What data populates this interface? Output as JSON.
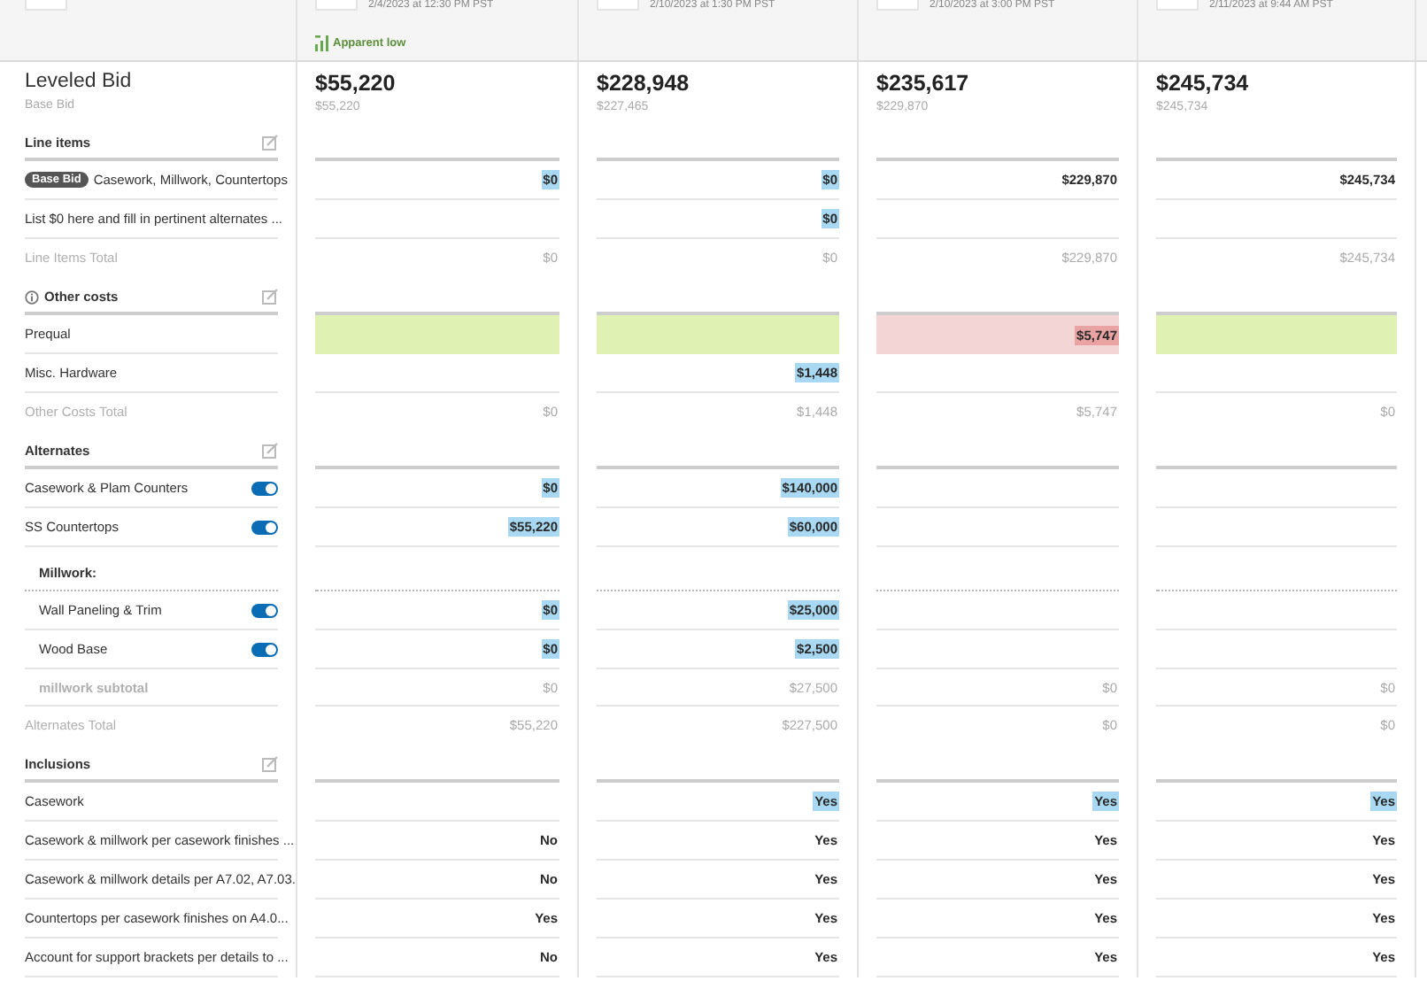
{
  "bidders": [
    {
      "date": "2/4/2023 at 12:30 PM PST",
      "badge": "Apparent low",
      "total": "$55,220",
      "subtotal": "$55,220"
    },
    {
      "date": "2/10/2023 at 1:30 PM PST",
      "total": "$228,948",
      "subtotal": "$227,465"
    },
    {
      "date": "2/10/2023 at 3:00 PM PST",
      "total": "$235,617",
      "subtotal": "$229,870"
    },
    {
      "date": "2/11/2023 at 9:44 AM PST",
      "total": "$245,734",
      "subtotal": "$245,734"
    }
  ],
  "summary": {
    "title": "Leveled Bid",
    "subtitle": "Base Bid"
  },
  "sections": [
    {
      "kind": "plain",
      "title": "Line items",
      "rows": [
        {
          "kind": "item",
          "tag": "Base Bid",
          "label": "Casework, Millwork, Countertops",
          "cells": [
            {
              "text": "$0",
              "selected": true
            },
            {
              "text": "$0",
              "selected": true
            },
            {
              "text": "$229,870",
              "selected": false
            },
            {
              "text": "$245,734",
              "selected": false
            }
          ]
        },
        {
          "kind": "item",
          "label": "List $0 here and fill in pertinent alternates ...",
          "cells": [
            {},
            {
              "text": "$0",
              "selected": true
            },
            {},
            {}
          ]
        },
        {
          "kind": "total",
          "label": "Line Items Total",
          "cells": [
            {
              "text": "$0"
            },
            {
              "text": "$0"
            },
            {
              "text": "$229,870"
            },
            {
              "text": "$245,734"
            }
          ]
        }
      ]
    },
    {
      "kind": "info",
      "title": "Other costs",
      "rows": [
        {
          "kind": "item",
          "label": "Prequal",
          "cells": [
            {
              "passed": true
            },
            {
              "passed": true
            },
            {
              "passed": false,
              "text": "$5,747",
              "flagged": true
            },
            {
              "passed": true
            }
          ]
        },
        {
          "kind": "item",
          "label": "Misc. Hardware",
          "cells": [
            {},
            {
              "text": "$1,448",
              "selected": true
            },
            {},
            {}
          ]
        },
        {
          "kind": "total",
          "label": "Other Costs Total",
          "cells": [
            {
              "text": "$0"
            },
            {
              "text": "$1,448"
            },
            {
              "text": "$5,747"
            },
            {
              "text": "$0"
            }
          ]
        }
      ]
    },
    {
      "kind": "plain",
      "title": "Alternates",
      "rows": [
        {
          "kind": "item",
          "label": "Casework & Plam Counters",
          "on": true,
          "cells": [
            {
              "text": "$0",
              "selected": true
            },
            {
              "text": "$140,000",
              "selected": true
            },
            {},
            {}
          ]
        },
        {
          "kind": "item",
          "label": "SS Countertops",
          "on": true,
          "cells": [
            {
              "text": "$55,220",
              "selected": true
            },
            {
              "text": "$60,000",
              "selected": true
            },
            {},
            {}
          ]
        },
        {
          "kind": "group",
          "label": "Millwork:",
          "children": [
            {
              "kind": "item",
              "label": "Wall Paneling & Trim",
              "on": true,
              "cells": [
                {
                  "text": "$0",
                  "selected": true
                },
                {
                  "text": "$25,000",
                  "selected": true
                },
                {},
                {}
              ]
            },
            {
              "kind": "item",
              "label": "Wood Base",
              "on": true,
              "cells": [
                {
                  "text": "$0",
                  "selected": true
                },
                {
                  "text": "$2,500",
                  "selected": true
                },
                {},
                {}
              ]
            },
            {
              "kind": "subtotal",
              "label": "millwork subtotal",
              "cells": [
                {
                  "text": "$0"
                },
                {
                  "text": "$27,500"
                },
                {
                  "text": "$0"
                },
                {
                  "text": "$0"
                }
              ]
            }
          ]
        },
        {
          "kind": "total",
          "label": "Alternates Total",
          "cells": [
            {
              "text": "$55,220"
            },
            {
              "text": "$227,500"
            },
            {
              "text": "$0"
            },
            {
              "text": "$0"
            }
          ]
        }
      ]
    },
    {
      "kind": "plain",
      "title": "Inclusions",
      "rows": [
        {
          "kind": "item",
          "label": "Casework",
          "cells": [
            {},
            {
              "text": "Yes",
              "selected": true
            },
            {
              "text": "Yes",
              "selected": true
            },
            {
              "text": "Yes",
              "selected": true
            }
          ]
        },
        {
          "kind": "item",
          "label": "Casework & millwork per casework finishes ...",
          "cells": [
            {
              "text": "No",
              "selected": false
            },
            {
              "text": "Yes",
              "selected": false
            },
            {
              "text": "Yes",
              "selected": false
            },
            {
              "text": "Yes",
              "selected": false
            }
          ]
        },
        {
          "kind": "item",
          "label": "Casework & millwork details per A7.02, A7.03.",
          "cells": [
            {
              "text": "No",
              "selected": false
            },
            {
              "text": "Yes",
              "selected": false
            },
            {
              "text": "Yes",
              "selected": false
            },
            {
              "text": "Yes",
              "selected": false
            }
          ]
        },
        {
          "kind": "item",
          "label": "Countertops per casework finishes on A4.0...",
          "cells": [
            {
              "text": "Yes",
              "selected": false
            },
            {
              "text": "Yes",
              "selected": false
            },
            {
              "text": "Yes",
              "selected": false
            },
            {
              "text": "Yes",
              "selected": false
            }
          ]
        },
        {
          "kind": "item",
          "label": "Account for support brackets per details to ...",
          "cells": [
            {
              "text": "No",
              "selected": false
            },
            {
              "text": "Yes",
              "selected": false
            },
            {
              "text": "Yes",
              "selected": false
            },
            {
              "text": "Yes",
              "selected": false
            }
          ]
        }
      ]
    }
  ]
}
